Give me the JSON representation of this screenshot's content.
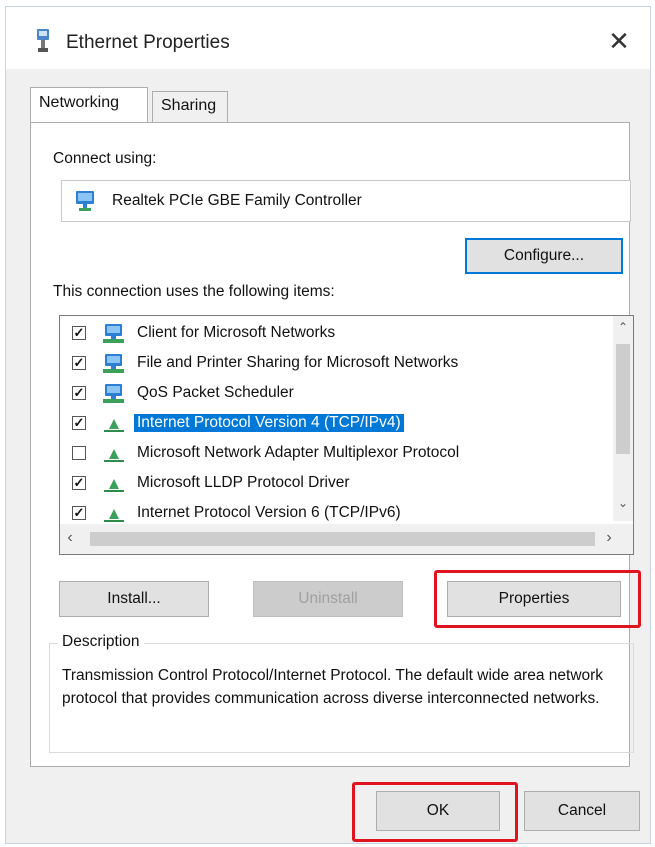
{
  "window": {
    "title": "Ethernet Properties",
    "close_glyph": "✕"
  },
  "tabs": [
    {
      "label": "Networking",
      "active": true
    },
    {
      "label": "Sharing",
      "active": false
    }
  ],
  "connect_using": {
    "label": "Connect using:",
    "adapter_name": "Realtek PCIe GBE Family Controller",
    "adapter_icon": "network-adapter-icon",
    "configure_label": "Configure..."
  },
  "items": {
    "label": "This connection uses the following items:",
    "list": [
      {
        "label": "Client for Microsoft Networks",
        "checked": true,
        "icon": "network-client-icon",
        "selected": false
      },
      {
        "label": "File and Printer Sharing for Microsoft Networks",
        "checked": true,
        "icon": "network-client-icon",
        "selected": false
      },
      {
        "label": "QoS Packet Scheduler",
        "checked": true,
        "icon": "network-client-icon",
        "selected": false
      },
      {
        "label": "Internet Protocol Version 4 (TCP/IPv4)",
        "checked": true,
        "icon": "protocol-icon",
        "selected": true
      },
      {
        "label": "Microsoft Network Adapter Multiplexor Protocol",
        "checked": false,
        "icon": "protocol-icon",
        "selected": false
      },
      {
        "label": "Microsoft LLDP Protocol Driver",
        "checked": true,
        "icon": "protocol-icon",
        "selected": false
      },
      {
        "label": "Internet Protocol Version 6 (TCP/IPv6)",
        "checked": true,
        "icon": "protocol-icon",
        "selected": false
      }
    ],
    "scroll_up": "⌃",
    "scroll_down": "⌄",
    "scroll_left": "‹",
    "scroll_right": "›"
  },
  "buttons": {
    "install": "Install...",
    "uninstall": "Uninstall",
    "properties": "Properties",
    "ok": "OK",
    "cancel": "Cancel"
  },
  "description": {
    "legend": "Description",
    "text": "Transmission Control Protocol/Internet Protocol. The default wide area network protocol that provides communication across diverse interconnected networks."
  },
  "colors": {
    "selection": "#0078d7",
    "highlight": "#e0141e",
    "dialog_bg": "#f0f0f0"
  }
}
